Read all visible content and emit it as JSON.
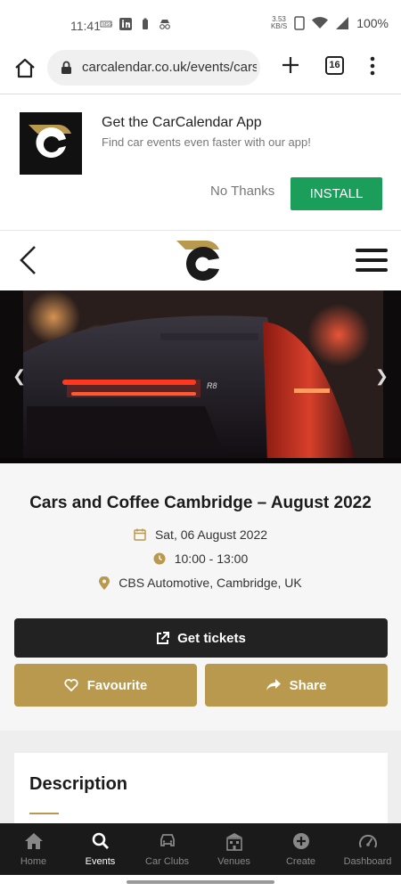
{
  "status_bar": {
    "time": "11:41",
    "net_speed_value": "3.53",
    "net_speed_unit": "KB/S",
    "battery": "100%"
  },
  "browser": {
    "url": "carcalendar.co.uk/events/cars",
    "tab_count": "16"
  },
  "app_banner": {
    "title": "Get the CarCalendar App",
    "subtitle": "Find car events even faster with our app!",
    "dismiss_label": "No Thanks",
    "install_label": "INSTALL"
  },
  "event": {
    "title": "Cars and Coffee Cambridge – August 2022",
    "date": "Sat, 06 August 2022",
    "time": "10:00 - 13:00",
    "location": "CBS Automotive, Cambridge, UK",
    "tickets_label": "Get tickets",
    "favourite_label": "Favourite",
    "share_label": "Share"
  },
  "description": {
    "heading": "Description"
  },
  "bottom_nav": [
    {
      "label": "Home",
      "icon": "home-icon",
      "active": false
    },
    {
      "label": "Events",
      "icon": "search-icon",
      "active": true
    },
    {
      "label": "Car Clubs",
      "icon": "car-icon",
      "active": false
    },
    {
      "label": "Venues",
      "icon": "building-icon",
      "active": false
    },
    {
      "label": "Create",
      "icon": "plus-circle-icon",
      "active": false
    },
    {
      "label": "Dashboard",
      "icon": "gauge-icon",
      "active": false
    }
  ],
  "colors": {
    "accent_gold": "#b8994e",
    "install_green": "#1a9e5a",
    "dark": "#222222"
  }
}
